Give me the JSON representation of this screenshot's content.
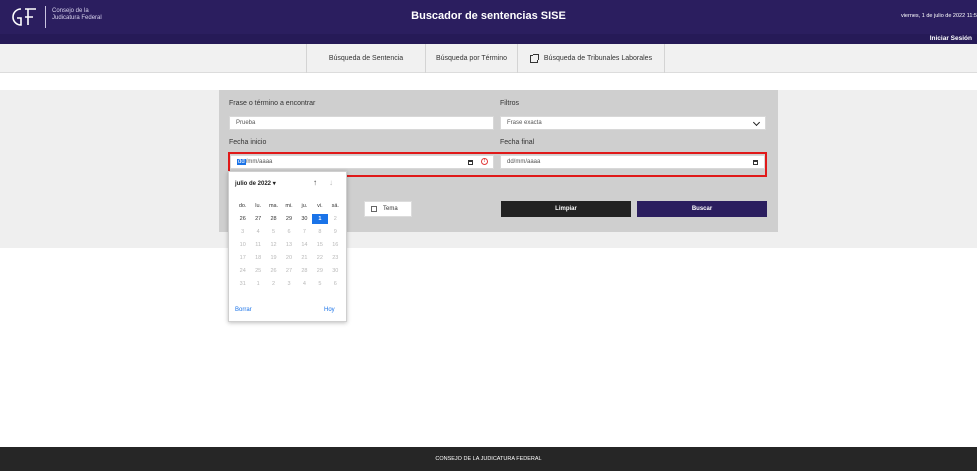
{
  "header": {
    "org_line1": "Consejo de la",
    "org_line2": "Judicatura Federal",
    "title": "Buscador de sentencias SISE",
    "date": "viernes, 1 de julio de 2022 11:5",
    "login": "Iniciar Sesión",
    "bg_color": "#2b1e5f"
  },
  "nav": {
    "tabs": [
      {
        "label": "Búsqueda de Sentencia"
      },
      {
        "label": "Búsqueda por Término"
      },
      {
        "label": "Búsqueda de Tribunales Laborales",
        "icon": "external-link-icon"
      }
    ]
  },
  "form": {
    "phrase_label": "Frase o término a encontrar",
    "phrase_value": "Prueba",
    "filters_label": "Filtros",
    "filters_value": "Frase exacta",
    "start_label": "Fecha inicio",
    "start_seg_dd": "dd",
    "start_rest": "/mm/aaaa",
    "end_label": "Fecha final",
    "end_value": "dd/mm/aaaa",
    "tema_label": "Tema",
    "clear_button": "Limpiar",
    "search_button": "Buscar",
    "clear_color": "#222222",
    "search_color": "#2b1e5f"
  },
  "calendar": {
    "month": "julio de 2022",
    "weekdays": [
      "do.",
      "lu.",
      "ma.",
      "mi.",
      "ju.",
      "vi.",
      "sá."
    ],
    "days": [
      "26",
      "27",
      "28",
      "29",
      "30",
      "1",
      "2",
      "3",
      "4",
      "5",
      "6",
      "7",
      "8",
      "9",
      "10",
      "11",
      "12",
      "13",
      "14",
      "15",
      "16",
      "17",
      "18",
      "19",
      "20",
      "21",
      "22",
      "23",
      "24",
      "25",
      "26",
      "27",
      "28",
      "29",
      "30",
      "31",
      "1",
      "2",
      "3",
      "4",
      "5",
      "6"
    ],
    "selected": "1",
    "clear": "Borrar",
    "today": "Hoy"
  },
  "footer": {
    "text": "CONSEJO DE LA JUDICATURA FEDERAL"
  }
}
